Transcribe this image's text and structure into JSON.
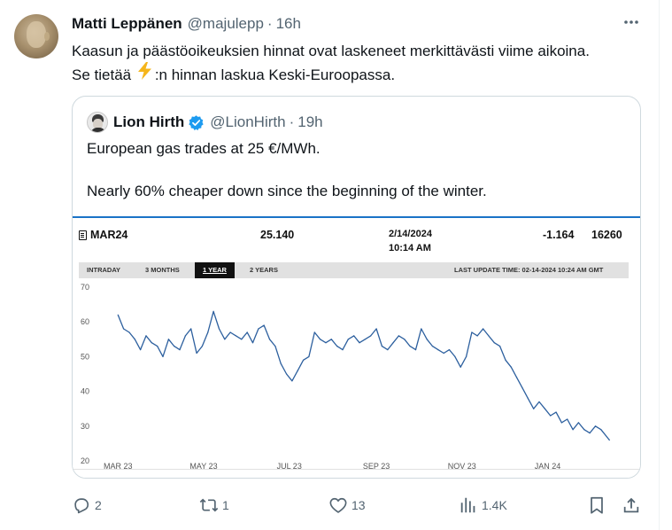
{
  "tweet": {
    "author_name": "Matti Leppänen",
    "handle": "@majulepp",
    "separator": "·",
    "time": "16h",
    "text_line1": "Kaasun ja päästöoikeuksien hinnat ovat laskeneet merkittävästi viime aikoina.",
    "text_line2_pre": "Se tietää ",
    "text_line2_emoji": "⚡",
    "text_line2_post": ":n hinnan laskua Keski-Euroopassa.",
    "more_label": "···"
  },
  "quote": {
    "author_name": "Lion Hirth",
    "handle": "@LionHirth",
    "separator": "·",
    "time": "19h",
    "text_p1": "European gas trades at 25 €/MWh.",
    "text_p2": "Nearly 60% cheaper down since the beginning of the winter."
  },
  "chart_header": {
    "symbol": "MAR24",
    "price": "25.140",
    "date": "2/14/2024",
    "clock": "10:14 AM",
    "change": "-1.164",
    "volume": "16260",
    "tabs": [
      "INTRADAY",
      "3 MONTHS",
      "1 YEAR",
      "2 YEARS"
    ],
    "active_tab": "1 YEAR",
    "last_update": "LAST UPDATE TIME: 02-14-2024 10:24 AM GMT"
  },
  "chart_data": {
    "type": "line",
    "title": "",
    "xlabel": "",
    "ylabel": "",
    "ylim": [
      20,
      70
    ],
    "y_ticks": [
      "70",
      "60",
      "50",
      "40",
      "30",
      "20"
    ],
    "x_ticks": [
      "MAR 23",
      "MAY 23",
      "JUL 23",
      "SEP 23",
      "NOV 23",
      "JAN 24"
    ],
    "line_color": "#2c5f9e",
    "series": [
      {
        "x": [
          "2023-03-01",
          "2023-03-05",
          "2023-03-09",
          "2023-03-13",
          "2023-03-17",
          "2023-03-21",
          "2023-03-25",
          "2023-03-29",
          "2023-04-02",
          "2023-04-06",
          "2023-04-10",
          "2023-04-14",
          "2023-04-18",
          "2023-04-22",
          "2023-04-26",
          "2023-04-30",
          "2023-05-04",
          "2023-05-08",
          "2023-05-12",
          "2023-05-16",
          "2023-05-20",
          "2023-05-24",
          "2023-05-28",
          "2023-06-01",
          "2023-06-05",
          "2023-06-09",
          "2023-06-13",
          "2023-06-17",
          "2023-06-21",
          "2023-06-25",
          "2023-06-29",
          "2023-07-03",
          "2023-07-07",
          "2023-07-11",
          "2023-07-15",
          "2023-07-19",
          "2023-07-23",
          "2023-07-27",
          "2023-07-31",
          "2023-08-04",
          "2023-08-08",
          "2023-08-12",
          "2023-08-16",
          "2023-08-20",
          "2023-08-24",
          "2023-08-28",
          "2023-09-01",
          "2023-09-05",
          "2023-09-09",
          "2023-09-13",
          "2023-09-17",
          "2023-09-21",
          "2023-09-25",
          "2023-09-29",
          "2023-10-03",
          "2023-10-07",
          "2023-10-11",
          "2023-10-15",
          "2023-10-19",
          "2023-10-23",
          "2023-10-27",
          "2023-10-31",
          "2023-11-04",
          "2023-11-08",
          "2023-11-12",
          "2023-11-16",
          "2023-11-20",
          "2023-11-24",
          "2023-11-28",
          "2023-12-02",
          "2023-12-06",
          "2023-12-10",
          "2023-12-14",
          "2023-12-18",
          "2023-12-22",
          "2023-12-26",
          "2023-12-30",
          "2024-01-03",
          "2024-01-07",
          "2024-01-11",
          "2024-01-15",
          "2024-01-19",
          "2024-01-23",
          "2024-01-27",
          "2024-01-31",
          "2024-02-04",
          "2024-02-08",
          "2024-02-14"
        ],
        "y": [
          62,
          58,
          57,
          55,
          52,
          56,
          54,
          53,
          50,
          55,
          53,
          52,
          56,
          58,
          51,
          53,
          57,
          63,
          58,
          55,
          57,
          56,
          55,
          57,
          54,
          58,
          59,
          55,
          53,
          48,
          45,
          43,
          46,
          49,
          50,
          57,
          55,
          54,
          55,
          53,
          52,
          55,
          56,
          54,
          55,
          56,
          58,
          53,
          52,
          54,
          56,
          55,
          53,
          52,
          58,
          55,
          53,
          52,
          51,
          52,
          50,
          47,
          50,
          57,
          56,
          58,
          56,
          54,
          53,
          49,
          47,
          44,
          41,
          38,
          35,
          37,
          35,
          33,
          34,
          31,
          32,
          29,
          31,
          29,
          28,
          30,
          29,
          26
        ]
      }
    ]
  },
  "actions": {
    "replies": "2",
    "reposts": "1",
    "likes": "13",
    "views": "1.4K"
  }
}
